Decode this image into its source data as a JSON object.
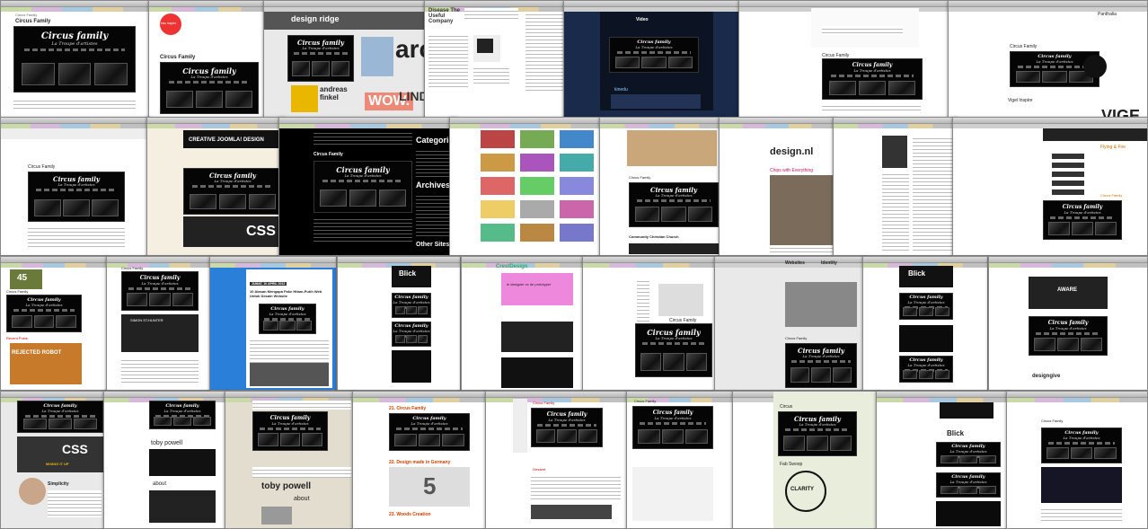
{
  "collage": {
    "row1": {
      "w1": {
        "breadcrumb": "Circus Family",
        "heading": "Circus Family"
      },
      "w2": {
        "badge": "kiss inspire",
        "heading": "Circus Family"
      },
      "w3": {
        "brand": "design ridge",
        "big1": "arc",
        "big2": "WOW.",
        "big3": "LIND",
        "author": "andreas finkel"
      },
      "w4": {
        "brand": "Disease The Useful Company"
      },
      "w5": {
        "video_label": "Video",
        "kinedu": "kinedu"
      },
      "w6": {
        "heading": "Circus Family"
      },
      "w7": {
        "heading": "Circus Family",
        "sub": "Vigel Inspire",
        "big": "VIGE",
        "brand": "Panthalia"
      }
    },
    "row2": {
      "w1": {
        "heading": "Circus Family"
      },
      "w2": {
        "banner": "CREATIVE JOOMLA! DESIGN",
        "css": "CSS"
      },
      "w3": {
        "heading": "Circus Family",
        "sidebar_title": "Categories",
        "archives": "Archives",
        "other": "Other Sites to"
      },
      "w4": {},
      "w5": {
        "heading": "Circus Family",
        "footer": "Community Christian Church"
      },
      "w6": {
        "brand": "design.nl",
        "tagline": "Chips with Everything"
      },
      "w7": {
        "heading": "Flying & Fire",
        "sub": "Circus Family"
      }
    },
    "row3": {
      "w1": {
        "counter": "45",
        "robot": "REJECTED ROBOT",
        "heading": "Circus Family",
        "sub": "Recent Posts"
      },
      "w2": {
        "heading": "Circus Family",
        "name": "SIMON ST.HUNTER"
      },
      "w3": {
        "heading": "10 Alasan Mengapa Fake Hitam-Putih Web Untuk Desain Website",
        "date": "JUMAT, 10 APRIL 2012"
      },
      "w4": {
        "heading": "Blick"
      },
      "w5": {
        "brand": "CrestDesign",
        "promo": "le designer xx de prototyper"
      },
      "w6": {
        "heading": "Circus Family"
      },
      "w7": {
        "label1": "Websites",
        "label2": "Identity",
        "heading": "Circus Family"
      },
      "w8": {
        "heading": "Blick"
      },
      "w9": {
        "heading": "AWARE",
        "brand": "designgive"
      }
    },
    "row4": {
      "w1": {
        "css": "CSS",
        "mixing": "MIXING IT UP",
        "simplicity": "Simplicity"
      },
      "w2": {
        "name": "toby powell",
        "about": "about"
      },
      "w3": {
        "name": "toby powell",
        "about": "about"
      },
      "w4": {
        "item1": "21. Circus Family",
        "item2": "22. Design made in Germany",
        "item3": "23. Woods Creation",
        "big": "5"
      },
      "w5": {
        "heading": "Circus Family",
        "sub": "Gesamt"
      },
      "w6": {
        "heading": "Circus Family"
      },
      "w7": {
        "heading": "Circus",
        "sub": "Fab Swoop",
        "badge": "CLARITY"
      },
      "w8": {
        "heading": "Blick"
      },
      "w9": {
        "heading": "Circus Family"
      }
    },
    "circus_logo": {
      "title": "Circus family",
      "subtitle": "La Troupe d'artistes"
    }
  }
}
